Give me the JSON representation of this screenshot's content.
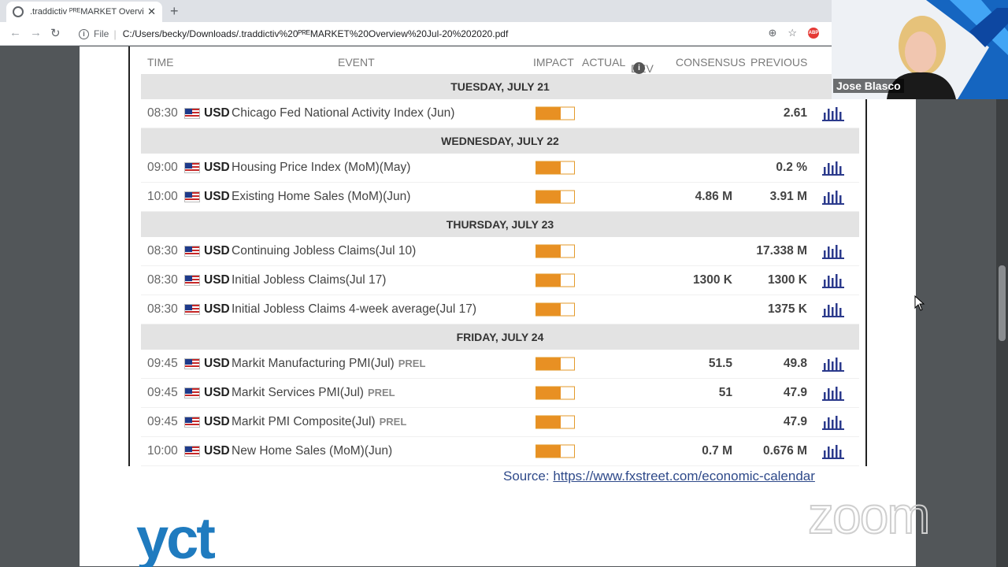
{
  "browser": {
    "tab_title": ".traddictiv ᴾᴿᴱMARKET Overview",
    "tab_close": "✕",
    "new_tab": "+",
    "scheme": "File",
    "url": "C:/Users/becky/Downloads/.traddictiv%20ᴾᴿᴱMARKET%20Overview%20Jul-20%202020.pdf",
    "adblock": "ABP"
  },
  "calendar": {
    "headers": {
      "time": "TIME",
      "event": "EVENT",
      "impact": "IMPACT",
      "actual": "ACTUAL",
      "dev": "DEV",
      "consensus": "CONSENSUS",
      "previous": "PREVIOUS"
    },
    "groups": [
      {
        "day": "TUESDAY, JULY 21",
        "rows": [
          {
            "time": "08:30",
            "currency": "USD",
            "event": "Chicago Fed National Activity Index (Jun)",
            "tag": "",
            "consensus": "",
            "previous": "2.61"
          }
        ]
      },
      {
        "day": "WEDNESDAY, JULY 22",
        "rows": [
          {
            "time": "09:00",
            "currency": "USD",
            "event": "Housing Price Index (MoM)(May)",
            "tag": "",
            "consensus": "",
            "previous": "0.2 %"
          },
          {
            "time": "10:00",
            "currency": "USD",
            "event": "Existing Home Sales (MoM)(Jun)",
            "tag": "",
            "consensus": "4.86 M",
            "previous": "3.91 M"
          }
        ]
      },
      {
        "day": "THURSDAY, JULY 23",
        "rows": [
          {
            "time": "08:30",
            "currency": "USD",
            "event": "Continuing Jobless Claims(Jul 10)",
            "tag": "",
            "consensus": "",
            "previous": "17.338 M"
          },
          {
            "time": "08:30",
            "currency": "USD",
            "event": "Initial Jobless Claims(Jul 17)",
            "tag": "",
            "consensus": "1300 K",
            "previous": "1300 K"
          },
          {
            "time": "08:30",
            "currency": "USD",
            "event": "Initial Jobless Claims 4-week average(Jul 17)",
            "tag": "",
            "consensus": "",
            "previous": "1375 K"
          }
        ]
      },
      {
        "day": "FRIDAY, JULY 24",
        "rows": [
          {
            "time": "09:45",
            "currency": "USD",
            "event": "Markit Manufacturing PMI(Jul)",
            "tag": "PREL",
            "consensus": "51.5",
            "previous": "49.8"
          },
          {
            "time": "09:45",
            "currency": "USD",
            "event": "Markit Services PMI(Jul)",
            "tag": "PREL",
            "consensus": "51",
            "previous": "47.9"
          },
          {
            "time": "09:45",
            "currency": "USD",
            "event": "Markit PMI Composite(Jul)",
            "tag": "PREL",
            "consensus": "",
            "previous": "47.9"
          },
          {
            "time": "10:00",
            "currency": "USD",
            "event": "New Home Sales (MoM)(Jun)",
            "tag": "",
            "consensus": "0.7 M",
            "previous": "0.676 M"
          }
        ]
      }
    ]
  },
  "source": {
    "label": "Source:",
    "link": "https://www.fxstreet.com/economic-calendar"
  },
  "logo_text": "yct",
  "video": {
    "participant_name": "Jose Blasco"
  },
  "watermark": "zoom",
  "colors": {
    "impact_fill": "#e89023",
    "link": "#2f4a8a",
    "logo": "#1f7bbf",
    "day_band": "#e3e3e3"
  }
}
